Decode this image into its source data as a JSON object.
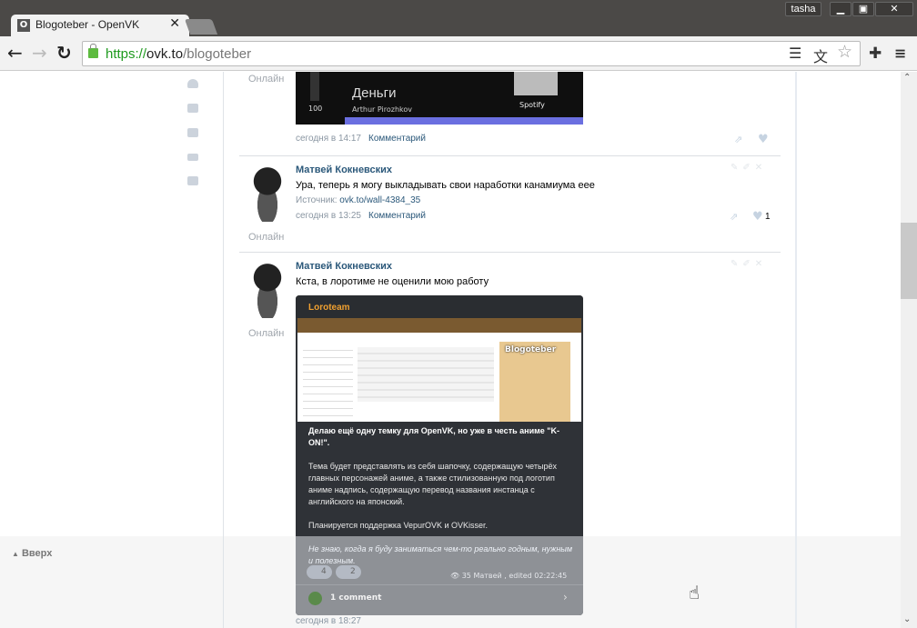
{
  "browser": {
    "tab_title": "Blogoteber - OpenVK",
    "favicon": "O",
    "user": "tasha",
    "url_scheme": "https://",
    "url_host": "ovk.to",
    "url_path": "/blogoteber"
  },
  "sidebar": {
    "icons": [
      "user-icon",
      "camera-icon",
      "mail-icon",
      "friends-icon",
      "chat-icon"
    ]
  },
  "player": {
    "volume": "100",
    "track": "Деньги",
    "artist": "Arthur Pirozhkov",
    "service": "Spotify"
  },
  "posts": [
    {
      "online": "Онлайн",
      "time": "сегодня в 14:17",
      "comment": "Комментарий"
    },
    {
      "author": "Матвей Кокневских",
      "text": "Ура, теперь я могу выкладывать свои наработки канамиума еее",
      "source_label": "Источник:",
      "source_link": "ovk.to/wall-4384_35",
      "time": "сегодня в 13:25",
      "comment": "Комментарий",
      "likes": "1",
      "online": "Онлайн"
    },
    {
      "author": "Матвей Кокневских",
      "text": "Кста, в лоротиме не оценили мою работу",
      "online": "Онлайн"
    }
  ],
  "embed": {
    "group": "Loroteam",
    "shot_title": "Blogoteber",
    "headline": "Делаю ещё одну темку для OpenVK, но уже в честь аниме \"K-ON!\".",
    "p1": "Тема будет представлять из себя шапочку, содержащую четырёх главных персонажей аниме, а также стилизованную под логотип аниме надпись, содержащую перевод названия инстанца с английского на японский.",
    "p2": "Планируется поддержка VepurOVK и OVKisser.",
    "p3": "Не знаю, когда я буду заниматься чем-то реально годным, нужным и полезным.",
    "reaction1": "4",
    "reaction2": "2",
    "views": "35",
    "footer_meta": "Матвей , edited 02:22:45",
    "comments": "1 comment"
  },
  "next_post_time": "сегодня в 18:27",
  "footer": {
    "up": "Вверх"
  }
}
